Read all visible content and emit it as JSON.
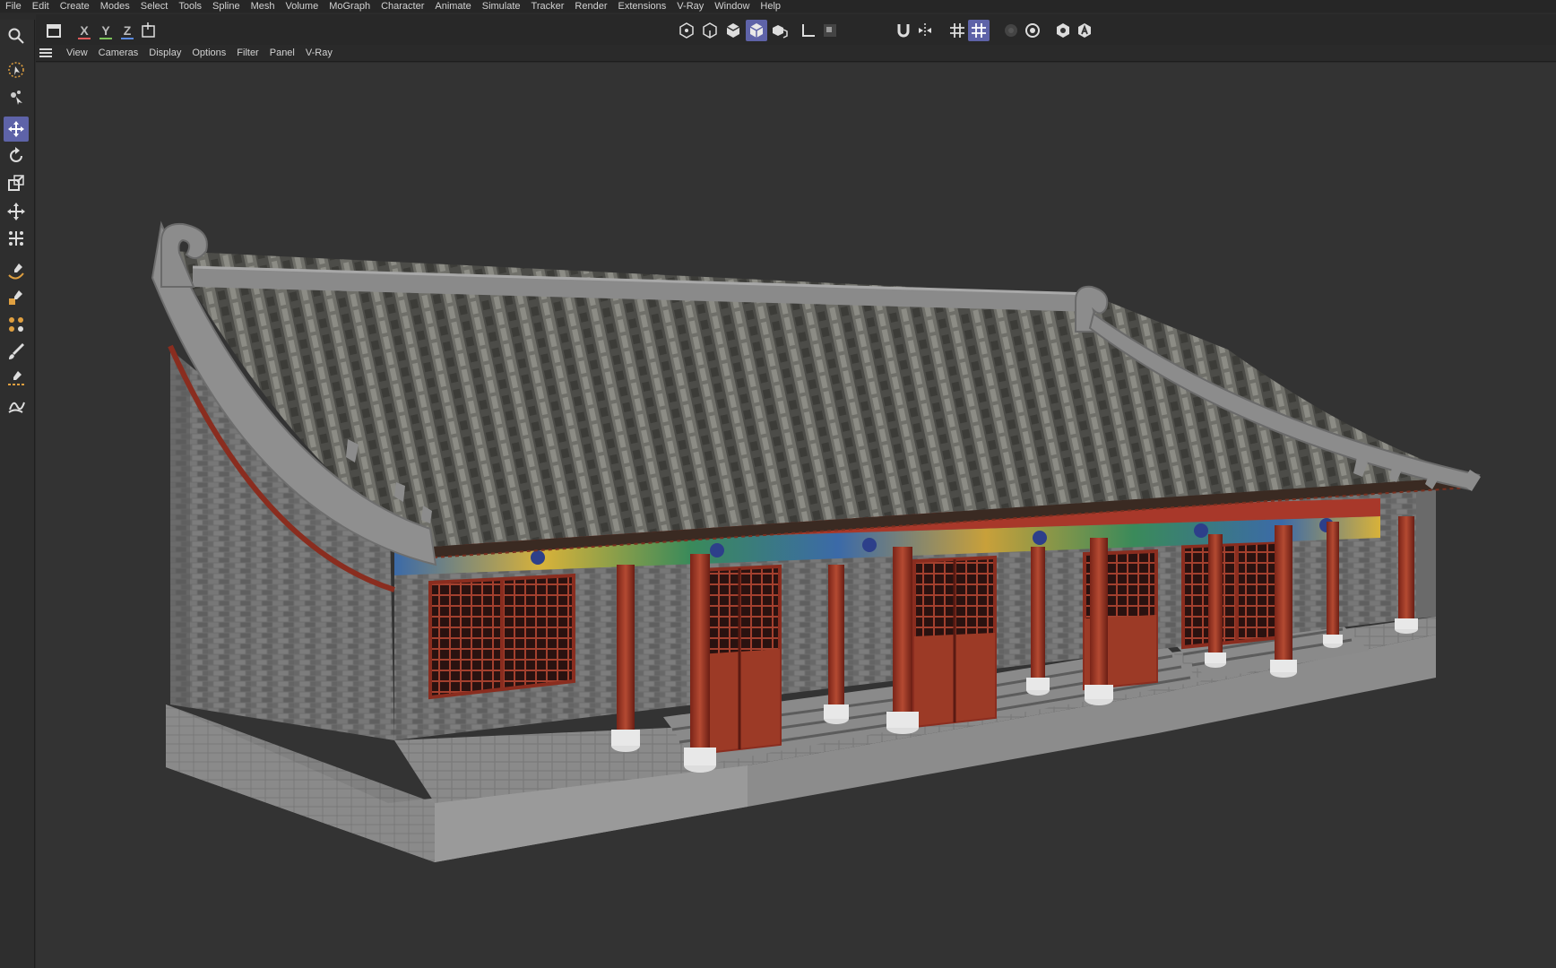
{
  "menu": [
    "File",
    "Edit",
    "Create",
    "Modes",
    "Select",
    "Tools",
    "Spline",
    "Mesh",
    "Volume",
    "MoGraph",
    "Character",
    "Animate",
    "Simulate",
    "Tracker",
    "Render",
    "Extensions",
    "V-Ray",
    "Window",
    "Help"
  ],
  "axes": {
    "x": "X",
    "y": "Y",
    "z": "Z"
  },
  "view_menu": [
    "View",
    "Cameras",
    "Display",
    "Options",
    "Filter",
    "Panel",
    "V-Ray"
  ],
  "colors": {
    "accent": "#5e63a8",
    "x_axis": "#e05a5a",
    "y_axis": "#7cc35a",
    "z_axis": "#5a8ae0"
  },
  "left_tools": [
    "search-icon",
    "live-selection-icon",
    "selection-tools-icon",
    "move-icon",
    "rotate-icon",
    "scale-icon",
    "transform-icon",
    "snap-transform-icon",
    "spline-pen-icon",
    "spline-shape-icon",
    "spline-extras-icon",
    "brush-icon",
    "knife-icon",
    "paint-icon"
  ],
  "top_tools": [
    "model-mode-icon",
    "point-mode-icon",
    "edge-mode-icon",
    "polygon-mode-icon",
    "uv-mode-icon",
    "axis-icon",
    "solo-icon",
    "magnet-icon",
    "symmetry-icon",
    "grid-icon",
    "grid-snap-icon",
    "render-view-icon",
    "render-settings-icon",
    "vray-icon",
    "vray-a-icon"
  ],
  "viewport": {
    "content": "3D model of a traditional Chinese hall with grey tile roof, red columns, painted beams, lattice windows, grey brick walls and stone stairs"
  }
}
